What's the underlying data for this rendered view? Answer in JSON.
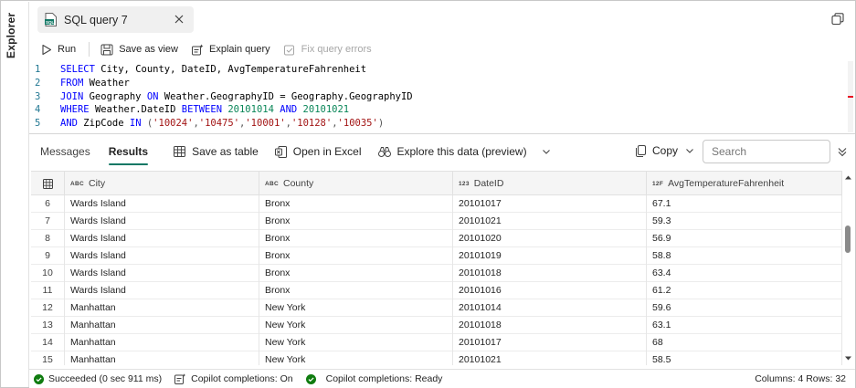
{
  "rail": {
    "label": "Explorer"
  },
  "tab": {
    "title": "SQL query 7",
    "file_icon_text": "SQL"
  },
  "toolbar": {
    "run": "Run",
    "save_as_view": "Save as view",
    "explain_query": "Explain query",
    "fix_query_errors": "Fix query errors"
  },
  "editor": {
    "lines": [
      {
        "n": "1",
        "tokens": [
          [
            "kw",
            "SELECT "
          ],
          [
            "id",
            "City, County, DateID, AvgTemperatureFahrenheit"
          ]
        ]
      },
      {
        "n": "2",
        "tokens": [
          [
            "kw",
            "FROM "
          ],
          [
            "id",
            "Weather"
          ]
        ]
      },
      {
        "n": "3",
        "tokens": [
          [
            "kw",
            "JOIN "
          ],
          [
            "id",
            "Geography "
          ],
          [
            "kw",
            "ON "
          ],
          [
            "id",
            "Weather.GeographyID = Geography.GeographyID"
          ]
        ]
      },
      {
        "n": "4",
        "tokens": [
          [
            "kw",
            "WHERE "
          ],
          [
            "id",
            "Weather.DateID "
          ],
          [
            "kw",
            "BETWEEN "
          ],
          [
            "num",
            "20101014 "
          ],
          [
            "kw",
            "AND "
          ],
          [
            "num",
            "20101021"
          ]
        ]
      },
      {
        "n": "5",
        "tokens": [
          [
            "kw",
            "AND "
          ],
          [
            "id",
            "ZipCode "
          ],
          [
            "kw",
            "IN "
          ],
          [
            "gray",
            "("
          ],
          [
            "str",
            "'10024'"
          ],
          [
            "gray",
            ","
          ],
          [
            "str",
            "'10475'"
          ],
          [
            "gray",
            ","
          ],
          [
            "str",
            "'10001'"
          ],
          [
            "gray",
            ","
          ],
          [
            "str",
            "'10128'"
          ],
          [
            "gray",
            ","
          ],
          [
            "str",
            "'10035'"
          ],
          [
            "gray",
            ")"
          ]
        ]
      }
    ]
  },
  "results_bar": {
    "tab_messages": "Messages",
    "tab_results": "Results",
    "save_as_table": "Save as table",
    "open_in_excel": "Open in Excel",
    "explore_data": "Explore this data (preview)",
    "copy": "Copy",
    "search_placeholder": "Search"
  },
  "grid": {
    "columns": [
      {
        "type": "ABC",
        "name": "City"
      },
      {
        "type": "ABC",
        "name": "County"
      },
      {
        "type": "123",
        "name": "DateID"
      },
      {
        "type": "12F",
        "name": "AvgTemperatureFahrenheit"
      }
    ],
    "rows": [
      [
        "6",
        "Wards Island",
        "Bronx",
        "20101017",
        "67.1"
      ],
      [
        "7",
        "Wards Island",
        "Bronx",
        "20101021",
        "59.3"
      ],
      [
        "8",
        "Wards Island",
        "Bronx",
        "20101020",
        "56.9"
      ],
      [
        "9",
        "Wards Island",
        "Bronx",
        "20101019",
        "58.8"
      ],
      [
        "10",
        "Wards Island",
        "Bronx",
        "20101018",
        "63.4"
      ],
      [
        "11",
        "Wards Island",
        "Bronx",
        "20101016",
        "61.2"
      ],
      [
        "12",
        "Manhattan",
        "New York",
        "20101014",
        "59.6"
      ],
      [
        "13",
        "Manhattan",
        "New York",
        "20101018",
        "63.1"
      ],
      [
        "14",
        "Manhattan",
        "New York",
        "20101017",
        "68"
      ],
      [
        "15",
        "Manhattan",
        "New York",
        "20101021",
        "58.5"
      ]
    ]
  },
  "status": {
    "succeeded": "Succeeded (0 sec 911 ms)",
    "copilot_on": "Copilot completions: On",
    "copilot_ready": "Copilot completions: Ready",
    "summary": "Columns: 4 Rows: 32"
  },
  "colors": {
    "accent": "#117865",
    "success": "#107c10",
    "keyword": "#0000ff",
    "number": "#098658",
    "string": "#a31515"
  }
}
